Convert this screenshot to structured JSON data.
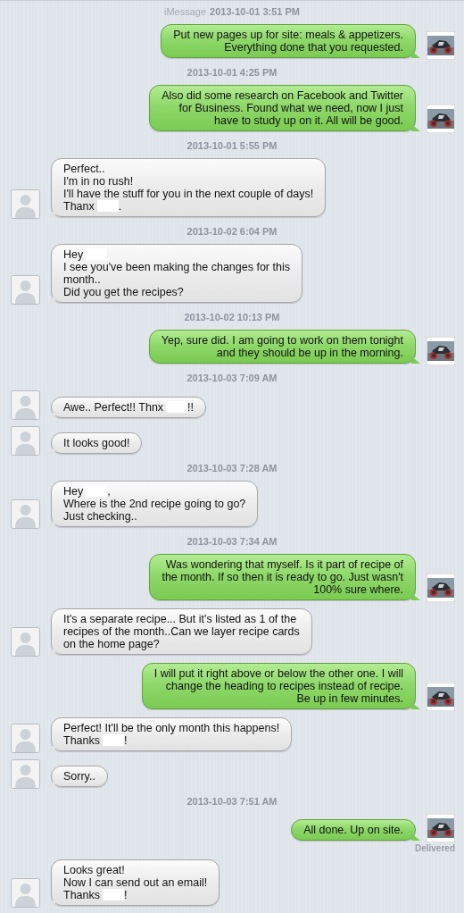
{
  "conversation": [
    {
      "kind": "timestamp",
      "service": "iMessage",
      "time": "2013-10-01 3:51 PM"
    },
    {
      "kind": "sent",
      "lines": [
        [
          {
            "text": "Put new pages up for site: meals & appetizers."
          }
        ],
        [
          {
            "text": "Everything done that you requested."
          }
        ]
      ]
    },
    {
      "kind": "timestamp",
      "time": "2013-10-01 4:25 PM"
    },
    {
      "kind": "sent",
      "lines": [
        [
          {
            "text": "Also did some research on Facebook and Twitter"
          }
        ],
        [
          {
            "text": "for Business. Found what we need, now I just"
          }
        ],
        [
          {
            "text": "have to study up on it. All will be good."
          }
        ]
      ]
    },
    {
      "kind": "timestamp",
      "time": "2013-10-01 5:55 PM"
    },
    {
      "kind": "received",
      "lines": [
        [
          {
            "text": "Perfect.."
          }
        ],
        [
          {
            "text": "I'm in no rush!"
          }
        ],
        [
          {
            "text": "I'll have the stuff for you in the next couple of days!"
          }
        ],
        [
          {
            "text": "Thanx"
          },
          {
            "kind": "redacted"
          },
          {
            "text": "."
          }
        ]
      ]
    },
    {
      "kind": "timestamp",
      "time": "2013-10-02 6:04 PM"
    },
    {
      "kind": "received",
      "lines": [
        [
          {
            "text": "Hey"
          },
          {
            "kind": "redacted"
          }
        ],
        [
          {
            "text": "I see you've been making the changes for this"
          }
        ],
        [
          {
            "text": "month.."
          }
        ],
        [
          {
            "text": "Did you get the recipes?"
          }
        ]
      ]
    },
    {
      "kind": "timestamp",
      "time": "2013-10-02 10:13 PM"
    },
    {
      "kind": "sent",
      "lines": [
        [
          {
            "text": "Yep, sure did. I am going to work on them tonight"
          }
        ],
        [
          {
            "text": "and they should be up in the morning."
          }
        ]
      ]
    },
    {
      "kind": "timestamp",
      "time": "2013-10-03 7:09 AM"
    },
    {
      "kind": "received",
      "lines": [
        [
          {
            "text": "Awe.. Perfect!! Thnx"
          },
          {
            "kind": "redacted"
          },
          {
            "text": "!!"
          }
        ]
      ]
    },
    {
      "kind": "received",
      "lines": [
        [
          {
            "text": "It looks good!"
          }
        ]
      ]
    },
    {
      "kind": "timestamp",
      "time": "2013-10-03 7:28 AM"
    },
    {
      "kind": "received",
      "lines": [
        [
          {
            "text": "Hey"
          },
          {
            "kind": "redacted"
          },
          {
            "text": ","
          }
        ],
        [
          {
            "text": "Where is the 2nd recipe going to go?"
          }
        ],
        [
          {
            "text": "Just checking.."
          }
        ]
      ]
    },
    {
      "kind": "timestamp",
      "time": "2013-10-03 7:34 AM"
    },
    {
      "kind": "sent",
      "lines": [
        [
          {
            "text": "Was wondering that myself. Is it part of recipe of"
          }
        ],
        [
          {
            "text": "the month. If so then it is ready to go. Just wasn't"
          }
        ],
        [
          {
            "text": "100% sure where."
          }
        ]
      ]
    },
    {
      "kind": "received",
      "lines": [
        [
          {
            "text": "It's a separate recipe... But it's listed as 1 of the"
          }
        ],
        [
          {
            "text": "recipes of the month..Can we layer recipe cards"
          }
        ],
        [
          {
            "text": "on the home page?"
          }
        ]
      ]
    },
    {
      "kind": "sent",
      "lines": [
        [
          {
            "text": "I will put it right above or below the other one. I will"
          }
        ],
        [
          {
            "text": "change the heading to recipes instead of recipe."
          }
        ],
        [
          {
            "text": "Be up in few minutes."
          }
        ]
      ]
    },
    {
      "kind": "received",
      "lines": [
        [
          {
            "text": "Perfect! It'll be the only month this happens!"
          }
        ],
        [
          {
            "text": "Thanks"
          },
          {
            "kind": "redacted"
          },
          {
            "text": "!"
          }
        ]
      ]
    },
    {
      "kind": "received",
      "lines": [
        [
          {
            "text": "Sorry.."
          }
        ]
      ]
    },
    {
      "kind": "timestamp",
      "time": "2013-10-03 7:51 AM"
    },
    {
      "kind": "sent",
      "lines": [
        [
          {
            "text": "All done. Up on site."
          }
        ]
      ]
    },
    {
      "kind": "status",
      "text": "Delivered"
    },
    {
      "kind": "received",
      "lines": [
        [
          {
            "text": "Looks great!"
          }
        ],
        [
          {
            "text": "Now I can send out an email!"
          }
        ],
        [
          {
            "text": "Thanks"
          },
          {
            "kind": "redacted"
          },
          {
            "text": "!"
          }
        ]
      ]
    }
  ]
}
